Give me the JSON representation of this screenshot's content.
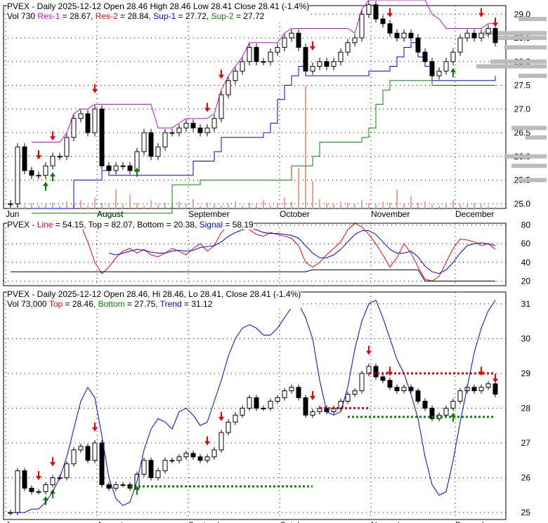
{
  "header1": {
    "line1": "PVEX - Daily 2025-12-12 Open 28.46  High 28.46  Low 28.41  Close 28.41 (-1.4%)",
    "vol": "Vol 730",
    "res1": "Res-1",
    "res1_val": " = 28.67, ",
    "res2": "Res-2",
    "res2_val": " = 28.84, ",
    "sup1": "Sup-1",
    "sup1_val": " = 27.72, ",
    "sup2": "Sup-2",
    "sup2_val": " = 27.72"
  },
  "header2": {
    "prefix": "PVEX - ",
    "line": "Line",
    "line_val": " = 54.15, Top = 82.07, Bottom = 20.38, ",
    "signal": "Signal",
    "signal_val": " = 58.19"
  },
  "header3": {
    "line1": "PVEX - Daily 2025-12-12 Open 28.46, Hi 28.46, Lo 28.41, Close 28.41 (-1.4%)",
    "vol": "Vol 73,000 ",
    "top": "Top",
    "top_val": " = 28.46, ",
    "bottom": "Bottom",
    "bottom_val": " = 27.75, ",
    "trend": "Trend",
    "trend_val": " = 31.12"
  },
  "chart_data": [
    {
      "type": "candlestick",
      "title": "PVEX - Daily",
      "x_labels": [
        "Jun",
        "August",
        "September",
        "October",
        "November",
        "December"
      ],
      "x_label_index": [
        0,
        13,
        26,
        39,
        52,
        64
      ],
      "yticks": [
        25.0,
        25.5,
        26.0,
        26.5,
        27.0,
        27.5,
        28.0,
        28.5,
        29.0
      ],
      "ylim": [
        24.9,
        29.3
      ],
      "close": [
        25.0,
        26.2,
        25.7,
        25.6,
        25.6,
        25.8,
        26.0,
        26.0,
        26.4,
        26.8,
        26.9,
        26.5,
        27.0,
        25.8,
        25.7,
        25.8,
        25.8,
        25.7,
        26.1,
        26.5,
        26.0,
        26.2,
        26.5,
        26.5,
        26.6,
        26.7,
        26.6,
        26.5,
        26.6,
        26.8,
        27.3,
        27.6,
        27.8,
        28.0,
        28.3,
        28.0,
        28.0,
        28.2,
        28.3,
        28.5,
        28.6,
        28.3,
        27.8,
        27.9,
        28.0,
        27.9,
        28.0,
        28.2,
        28.4,
        28.5,
        29.0,
        29.2,
        28.9,
        28.8,
        28.6,
        28.5,
        28.6,
        28.5,
        28.2,
        28.0,
        27.7,
        27.8,
        28.0,
        28.2,
        28.5,
        28.6,
        28.5,
        28.6,
        28.7,
        28.4
      ],
      "volume": [
        3,
        5,
        2,
        4,
        2,
        3,
        4,
        2,
        5,
        3,
        6,
        2,
        8,
        4,
        3,
        14,
        3,
        10,
        4,
        2,
        6,
        3,
        4,
        2,
        5,
        3,
        7,
        2,
        4,
        3,
        2,
        3,
        5,
        2,
        4,
        3,
        6,
        2,
        4,
        8,
        5,
        30,
        90,
        20,
        7,
        4,
        3,
        5,
        4,
        3,
        6,
        4,
        3,
        5,
        4,
        14,
        3,
        9,
        4,
        5,
        3,
        2,
        4,
        6,
        3,
        3,
        4,
        3,
        2,
        1
      ],
      "arrows_down": [
        4,
        6,
        12,
        28,
        30,
        43,
        51,
        54,
        67,
        69
      ],
      "arrows_up": [
        5,
        6,
        18,
        63
      ],
      "series_names": [
        "Res-1",
        "Res-2",
        "Sup-1",
        "Sup-2"
      ]
    },
    {
      "type": "line",
      "yticks": [
        20,
        40,
        60,
        80
      ],
      "ylim": [
        15,
        88
      ],
      "series": [
        {
          "name": "Line",
          "values": [
            null,
            null,
            null,
            null,
            null,
            null,
            null,
            null,
            null,
            null,
            80,
            62,
            40,
            28,
            35,
            45,
            52,
            55,
            50,
            54,
            48,
            46,
            50,
            55,
            52,
            48,
            55,
            60,
            52,
            58,
            72,
            80,
            78,
            80,
            75,
            70,
            68,
            72,
            70,
            68,
            66,
            58,
            40,
            35,
            40,
            48,
            55,
            62,
            75,
            82,
            78,
            70,
            60,
            48,
            35,
            45,
            60,
            50,
            35,
            22,
            20,
            25,
            40,
            55,
            65,
            64,
            62,
            58,
            60,
            54
          ]
        },
        {
          "name": "Signal",
          "values": [
            null,
            null,
            null,
            null,
            null,
            null,
            null,
            null,
            null,
            null,
            null,
            null,
            null,
            null,
            50,
            48,
            50,
            52,
            54,
            53,
            51,
            50,
            50,
            52,
            53,
            52,
            53,
            56,
            57,
            58,
            62,
            68,
            72,
            75,
            76,
            75,
            72,
            71,
            71,
            70,
            69,
            66,
            58,
            50,
            45,
            45,
            48,
            54,
            62,
            70,
            74,
            74,
            70,
            62,
            54,
            50,
            50,
            52,
            46,
            36,
            30,
            28,
            32,
            40,
            50,
            58,
            60,
            61,
            60,
            58
          ]
        },
        {
          "name": "Top",
          "values": [
            82,
            82,
            82,
            82,
            82,
            82,
            82,
            82,
            82,
            82,
            82,
            82,
            82,
            82,
            82,
            82,
            82,
            82,
            82,
            82,
            82,
            82,
            82,
            82,
            82,
            82,
            82,
            82,
            82,
            82,
            82,
            82,
            82,
            82,
            82,
            82,
            82,
            82,
            82,
            82,
            82,
            82,
            82,
            82,
            82,
            82,
            82,
            82,
            82,
            82,
            82,
            82,
            82,
            82,
            82,
            82,
            82,
            82,
            82,
            82,
            82,
            82,
            82,
            82,
            82,
            82,
            82,
            82,
            82,
            82
          ]
        },
        {
          "name": "Bottom",
          "values": [
            30,
            30,
            30,
            30,
            30,
            30,
            30,
            30,
            30,
            30,
            30,
            30,
            30,
            30,
            30,
            30,
            30,
            30,
            30,
            30,
            30,
            30,
            30,
            30,
            30,
            30,
            30,
            30,
            30,
            30,
            30,
            30,
            30,
            30,
            30,
            30,
            30,
            30,
            30,
            30,
            30,
            30,
            30,
            32,
            32,
            32,
            32,
            32,
            32,
            32,
            32,
            32,
            32,
            32,
            32,
            32,
            32,
            32,
            32,
            20,
            20,
            20,
            20,
            20,
            20,
            20,
            20,
            20,
            20,
            20
          ]
        }
      ]
    },
    {
      "type": "candlestick",
      "yticks": [
        25,
        26,
        27,
        28,
        29,
        30,
        31
      ],
      "ylim": [
        24.8,
        31.5
      ],
      "trend": [
        25.0,
        25.0,
        25.0,
        25.1,
        25.1,
        25.3,
        25.6,
        26.0,
        26.6,
        27.4,
        28.2,
        28.6,
        28.3,
        27.2,
        26.0,
        25.4,
        25.2,
        25.3,
        25.9,
        26.8,
        27.4,
        27.7,
        27.6,
        27.4,
        27.9,
        28.0,
        27.8,
        27.5,
        27.6,
        28.2,
        28.8,
        29.5,
        30.0,
        30.3,
        30.4,
        30.3,
        30.1,
        30.1,
        30.3,
        30.6,
        30.9,
        31.0,
        30.6,
        30.0,
        28.8,
        27.9,
        27.8,
        27.9,
        28.6,
        29.7,
        30.5,
        31.0,
        31.1,
        30.6,
        30.0,
        29.4,
        29.0,
        28.4,
        27.7,
        26.6,
        25.8,
        25.5,
        25.6,
        26.5,
        27.6,
        28.6,
        29.6,
        30.3,
        30.8,
        31.1
      ],
      "levels": [
        {
          "color": "red",
          "value": 29.0,
          "from": 51,
          "to": 69
        },
        {
          "color": "green",
          "value": 27.75,
          "from": 48,
          "to": 69
        },
        {
          "color": "green",
          "value": 25.75,
          "from": 17,
          "to": 43
        },
        {
          "color": "red",
          "value": 28.0,
          "from": 44,
          "to": 51
        }
      ]
    }
  ]
}
